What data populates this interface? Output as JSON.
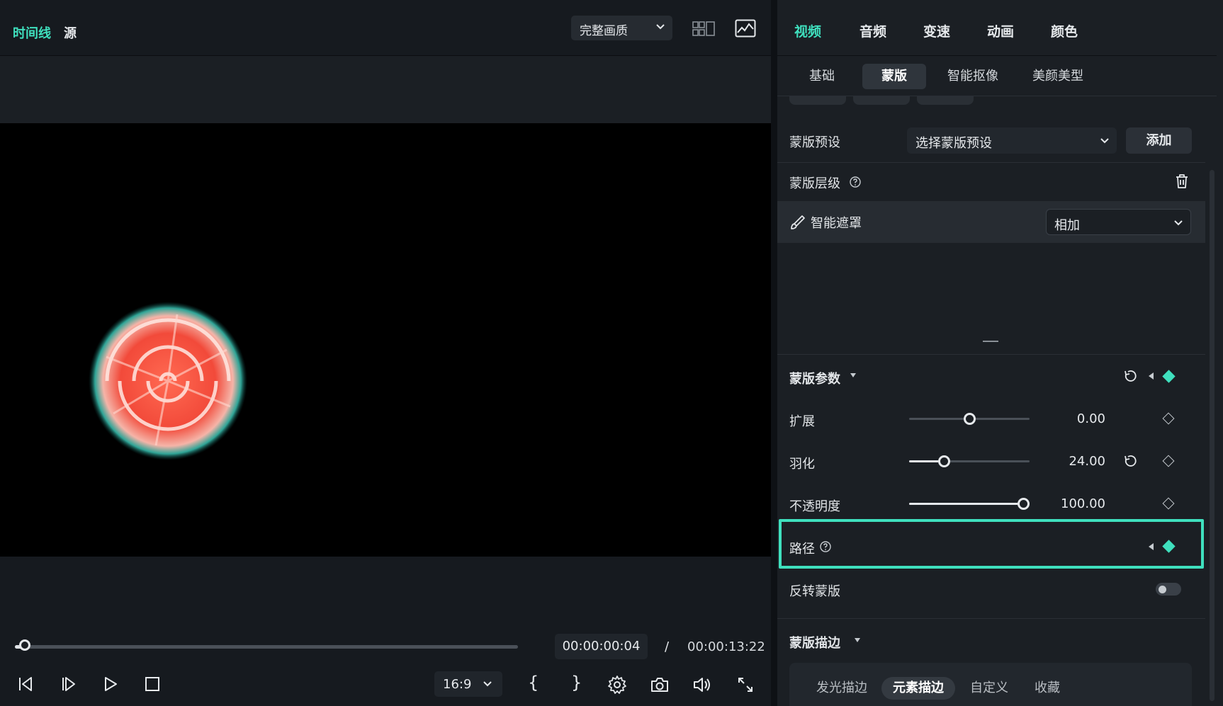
{
  "left": {
    "tabs": [
      {
        "label": "时间线",
        "active": true
      },
      {
        "label": "源",
        "active": false
      }
    ],
    "quality": "完整画质",
    "timecode_current": "00:00:00:04",
    "timecode_separator": "/",
    "timecode_total": "00:00:13:22",
    "aspect_ratio": "16:9",
    "seek_progress": 0.02,
    "controls": {
      "mark_in": "{",
      "mark_out": "}"
    }
  },
  "right": {
    "tabs": [
      {
        "label": "视频",
        "active": true
      },
      {
        "label": "音频",
        "active": false
      },
      {
        "label": "变速",
        "active": false
      },
      {
        "label": "动画",
        "active": false
      },
      {
        "label": "颜色",
        "active": false
      }
    ],
    "sub_tabs": [
      {
        "label": "基础",
        "active": false
      },
      {
        "label": "蒙版",
        "active": true
      },
      {
        "label": "智能抠像",
        "active": false
      },
      {
        "label": "美颜美型",
        "active": false
      }
    ],
    "mask_preset": {
      "label": "蒙版预设",
      "placeholder": "选择蒙版预设",
      "add_label": "添加"
    },
    "mask_layer": {
      "label": "蒙版层级",
      "item_label": "智能遮罩",
      "blend_mode": "相加"
    },
    "mask_params": {
      "label": "蒙版参数",
      "params": [
        {
          "label": "扩展",
          "value": "0.00",
          "fraction": 0.5
        },
        {
          "label": "羽化",
          "value": "24.00",
          "fraction": 0.27
        },
        {
          "label": "不透明度",
          "value": "100.00",
          "fraction": 1.0
        }
      ],
      "path_label": "路径",
      "invert_label": "反转蒙版",
      "invert_on": false
    },
    "mask_stroke": {
      "label": "蒙版描边",
      "tabs": [
        {
          "label": "发光描边",
          "active": false
        },
        {
          "label": "元素描边",
          "active": true
        },
        {
          "label": "自定义",
          "active": false
        },
        {
          "label": "收藏",
          "active": false
        }
      ]
    },
    "accent_color": "#3fe0be"
  }
}
